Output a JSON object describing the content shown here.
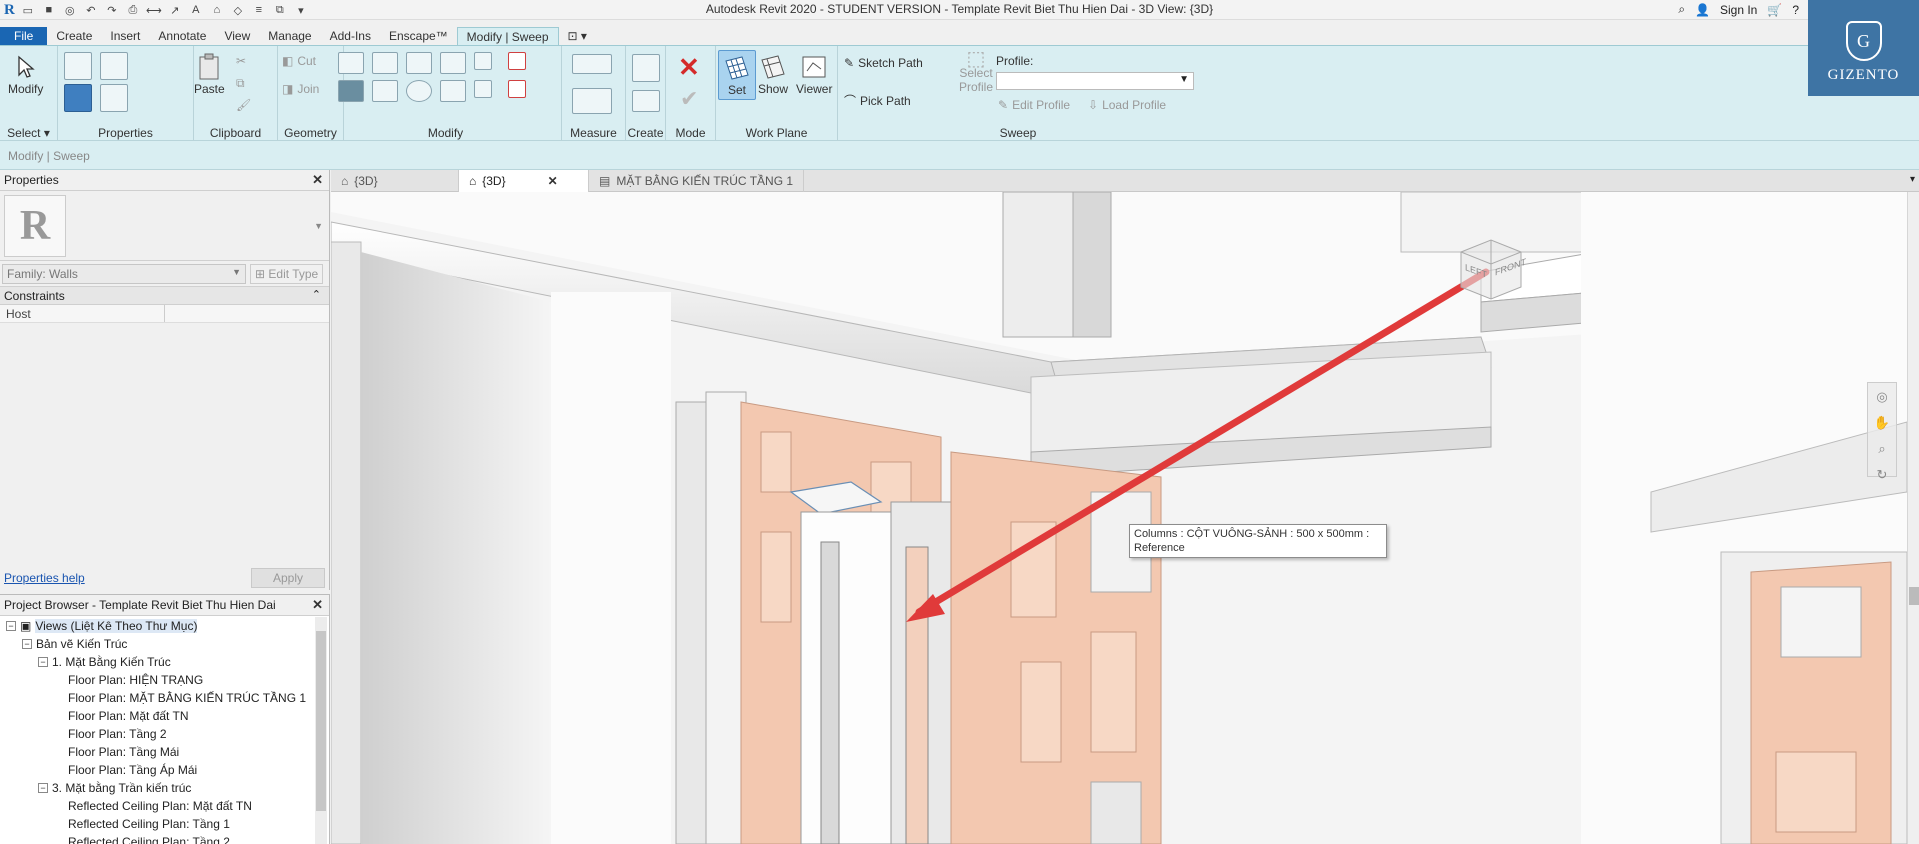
{
  "title": {
    "app_logo": "R",
    "window_title": "Autodesk Revit 2020 - STUDENT VERSION - Template Revit Biet Thu Hien Dai - 3D View: {3D}",
    "sign_in": "Sign In",
    "help": "?",
    "close": "✕"
  },
  "ribbon_tabs": [
    "File",
    "Create",
    "Insert",
    "Annotate",
    "View",
    "Manage",
    "Add-Ins",
    "Enscape™",
    "Modify | Sweep"
  ],
  "ribbon": {
    "modify": "Modify",
    "paste": "Paste",
    "cut": "Cut",
    "join": "Join",
    "set": "Set",
    "show": "Show",
    "viewer": "Viewer",
    "sketch_path": "Sketch Path",
    "pick_path": "Pick Path",
    "select_profile": "Select Profile",
    "profile_label": "Profile:",
    "edit_profile": "Edit Profile",
    "load_profile": "Load Profile",
    "panels": {
      "select": "Select ▾",
      "properties": "Properties",
      "clipboard": "Clipboard",
      "geometry": "Geometry",
      "modify": "Modify",
      "measure": "Measure",
      "create": "Create",
      "mode": "Mode",
      "work_plane": "Work Plane",
      "sweep": "Sweep"
    }
  },
  "options_bar": "Modify | Sweep",
  "properties": {
    "title": "Properties",
    "type_thumb": "R",
    "family": "Family: Walls",
    "edit_type": "Edit Type",
    "section": "Constraints",
    "rows": [
      {
        "key": "Host",
        "value": ""
      }
    ],
    "help": "Properties help",
    "apply": "Apply"
  },
  "view_tabs": [
    {
      "label": "{3D}",
      "active": false
    },
    {
      "label": "{3D}",
      "active": true
    },
    {
      "label": "MẶT BẰNG KIẾN TRÚC TẦNG 1",
      "active": false
    }
  ],
  "tooltip": {
    "line1": "Columns : CỘT VUÔNG-SẢNH : 500 x 500mm :",
    "line2": "Reference"
  },
  "browser": {
    "title": "Project Browser - Template Revit Biet Thu Hien Dai",
    "items": [
      {
        "label": "Views (Liệt Kê Theo Thư Mục)",
        "level": 0,
        "toggle": "−",
        "selected": true
      },
      {
        "label": "Bản vẽ Kiến Trúc",
        "level": 1,
        "toggle": "−"
      },
      {
        "label": "1. Mặt Bằng Kiến Trúc",
        "level": 2,
        "toggle": "−"
      },
      {
        "label": "Floor Plan: HIỆN TRẠNG",
        "level": 3,
        "toggle": ""
      },
      {
        "label": "Floor Plan: MẶT BẰNG KIẾN TRÚC TẦNG 1",
        "level": 3,
        "toggle": ""
      },
      {
        "label": "Floor Plan: Mặt đất TN",
        "level": 3,
        "toggle": ""
      },
      {
        "label": "Floor Plan: Tầng 2",
        "level": 3,
        "toggle": ""
      },
      {
        "label": "Floor Plan: Tầng Mái",
        "level": 3,
        "toggle": ""
      },
      {
        "label": "Floor Plan: Tầng Áp Mái",
        "level": 3,
        "toggle": ""
      },
      {
        "label": "3. Mặt bằng Trần kiến trúc",
        "level": 2,
        "toggle": "−"
      },
      {
        "label": "Reflected Ceiling Plan: Mặt đất TN",
        "level": 3,
        "toggle": ""
      },
      {
        "label": "Reflected Ceiling Plan: Tầng 1",
        "level": 3,
        "toggle": ""
      },
      {
        "label": "Reflected Ceiling Plan: Tầng 2",
        "level": 3,
        "toggle": ""
      }
    ]
  },
  "viewcube": {
    "left": "LEFT",
    "front": "FRONT"
  },
  "logo": {
    "letter": "G",
    "word": "GIZENTO"
  },
  "colors": {
    "accent": "#1a66b3",
    "ribbon": "#d9eef2",
    "arrow": "#e03a3a",
    "door": "#f2c6ad",
    "logo_bg": "#3e74a4"
  }
}
